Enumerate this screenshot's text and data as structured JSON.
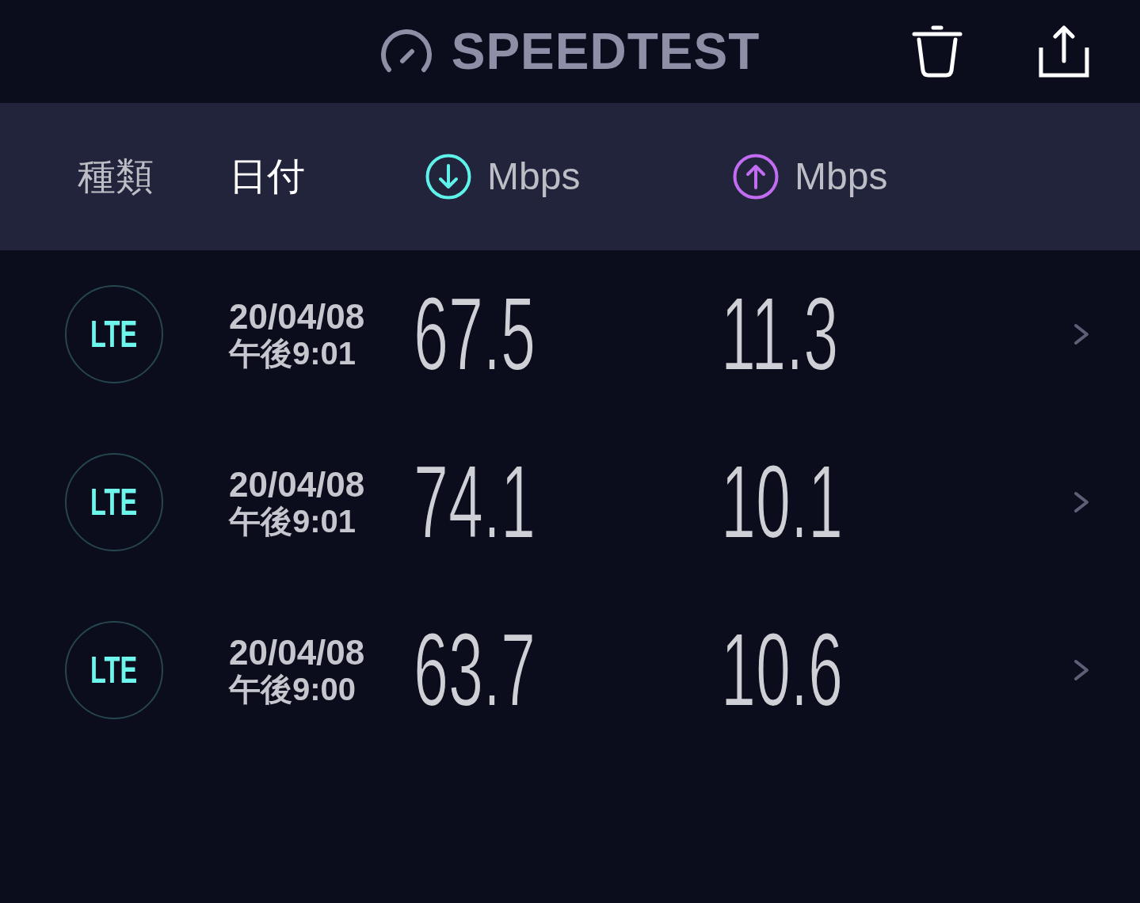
{
  "header": {
    "title": "SPEEDTEST"
  },
  "columns": [
    {
      "kind": "text",
      "label": "種類",
      "selected": false
    },
    {
      "kind": "text",
      "label": "日付",
      "selected": true
    },
    {
      "kind": "download",
      "label": "Mbps",
      "selected": false
    },
    {
      "kind": "upload",
      "label": "Mbps",
      "selected": false
    }
  ],
  "results": [
    {
      "type": "LTE",
      "date": "20/04/08",
      "time": "午後9:01",
      "download": "67.5",
      "upload": "11.3"
    },
    {
      "type": "LTE",
      "date": "20/04/08",
      "time": "午後9:01",
      "download": "74.1",
      "upload": "10.1"
    },
    {
      "type": "LTE",
      "date": "20/04/08",
      "time": "午後9:00",
      "download": "63.7",
      "upload": "10.6"
    }
  ]
}
